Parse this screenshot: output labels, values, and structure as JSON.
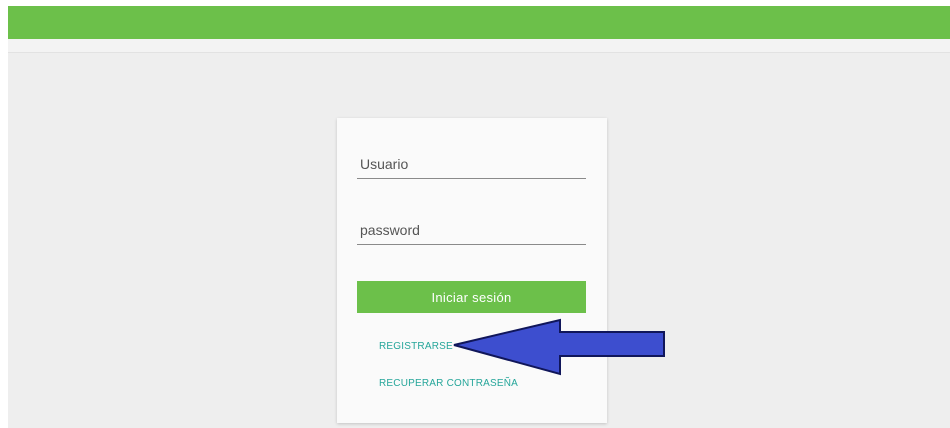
{
  "header": {
    "accent_color": "#6cc04a"
  },
  "login_form": {
    "username_placeholder": "Usuario",
    "password_placeholder": "password",
    "login_button_label": "Iniciar sesión",
    "register_link_label": "REGISTRARSE",
    "recover_link_label": "RECUPERAR CONTRASEÑA",
    "link_color": "#26a69a"
  },
  "annotation": {
    "arrow_icon": "left-arrow-icon",
    "arrow_color": "#3d4ecf"
  }
}
